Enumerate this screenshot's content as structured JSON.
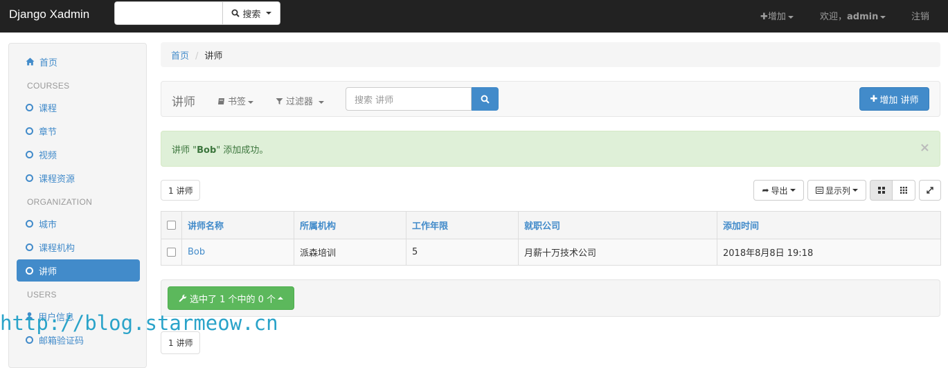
{
  "navbar": {
    "brand": "Django Xadmin",
    "search_button": "搜索",
    "add_label": "增加",
    "welcome": "欢迎，",
    "username": "admin",
    "logout": "注销"
  },
  "sidebar": {
    "home": "首页",
    "sections": [
      {
        "header": "COURSES",
        "items": [
          "课程",
          "章节",
          "视频",
          "课程资源"
        ]
      },
      {
        "header": "ORGANIZATION",
        "items": [
          "城市",
          "课程机构",
          "讲师"
        ]
      },
      {
        "header": "USERS",
        "items": [
          "用户信息",
          "邮箱验证码"
        ]
      }
    ],
    "active_item": "讲师"
  },
  "breadcrumb": {
    "home": "首页",
    "separator": "/",
    "current": "讲师"
  },
  "toolbar": {
    "title": "讲师",
    "bookmarks": "书签",
    "filters": "过滤器",
    "search_placeholder": "搜索 讲师",
    "add_button": "增加 讲师"
  },
  "alert": {
    "prefix": "讲师 \"",
    "name": "Bob",
    "suffix": "\" 添加成功。",
    "close": "×"
  },
  "list_controls": {
    "count": "1 讲师",
    "export": "导出",
    "columns": "显示列"
  },
  "table": {
    "columns": [
      "讲师名称",
      "所属机构",
      "工作年限",
      "就职公司",
      "添加时间"
    ],
    "rows": [
      [
        "Bob",
        "派森培训",
        "5",
        "月薪十万技术公司",
        "2018年8月8日 19:18"
      ]
    ]
  },
  "actions": {
    "selected_label": "选中了 1 个中的 0 个"
  },
  "footer": {
    "count": "1 讲师"
  },
  "watermark": "http://blog.starmeow.cn",
  "colors": {
    "primary": "#428bca",
    "success": "#5cb85c",
    "navbar": "#222222",
    "alert_bg": "#dff0d8"
  }
}
